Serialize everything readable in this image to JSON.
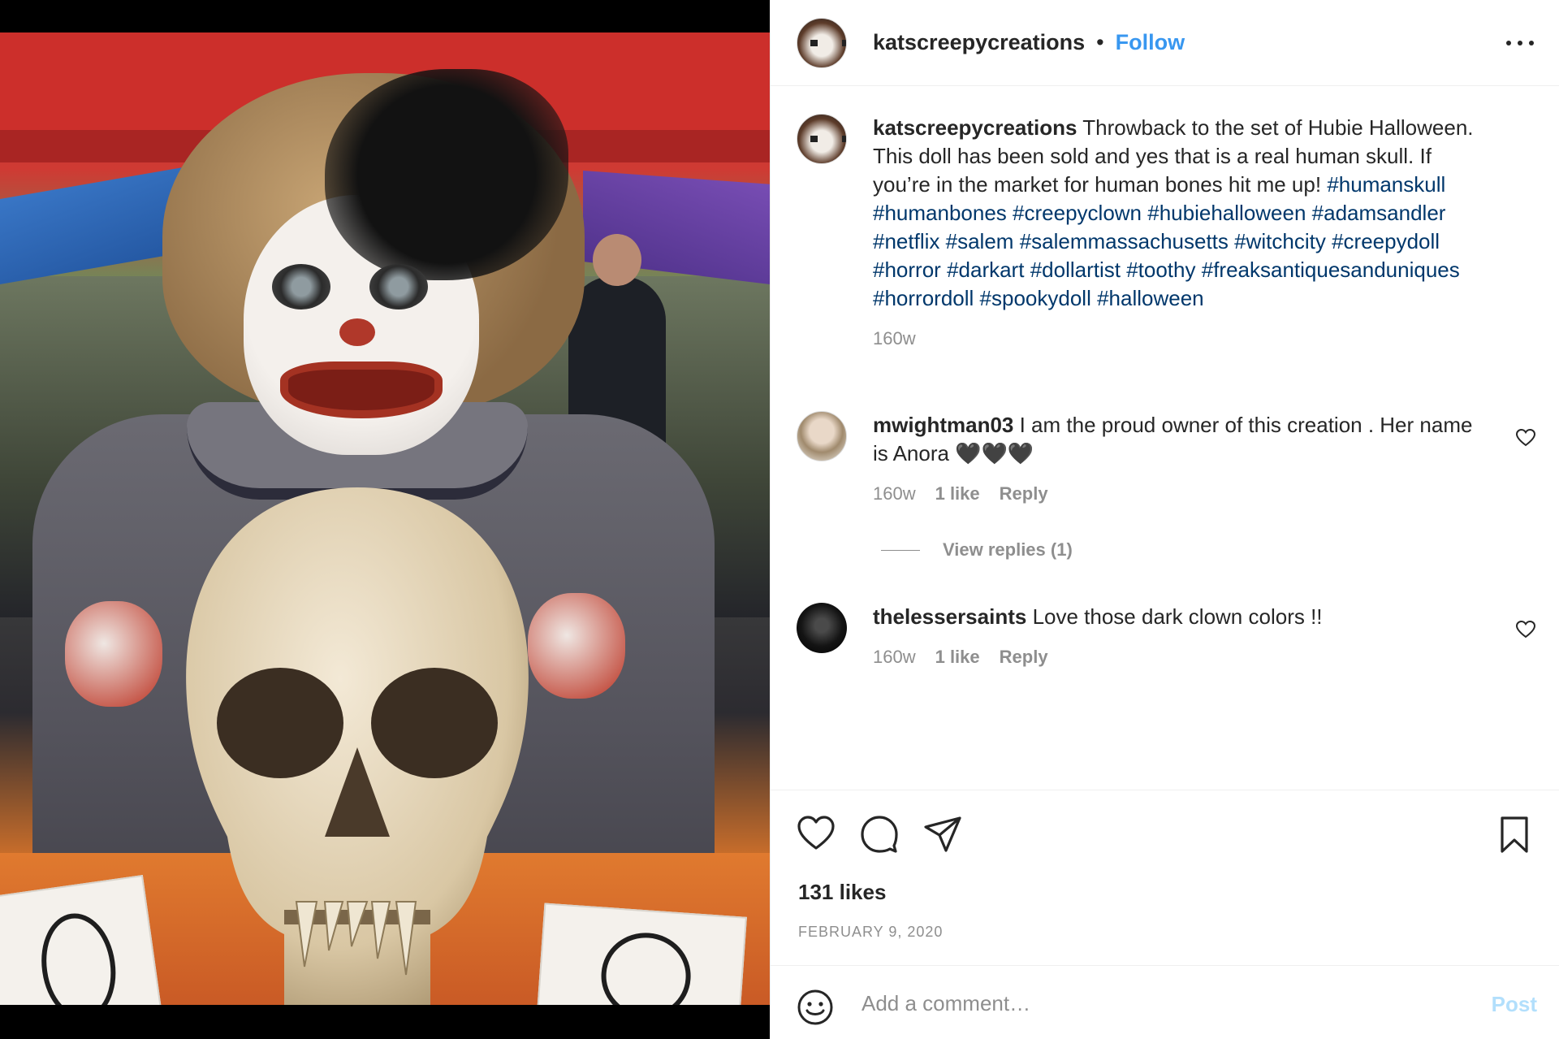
{
  "post": {
    "username": "katscreepycreations",
    "follow_label": "Follow",
    "separator": "•"
  },
  "caption": {
    "username": "katscreepycreations",
    "text": "Throwback to the set of Hubie Halloween. This doll has been sold and yes that is a real human skull. If you’re in the market for human bones hit me up!",
    "hashtags": [
      "#humanskull",
      "#humanbones",
      "#creepyclown",
      "#hubiehalloween",
      "#adamsandler",
      "#netflix",
      "#salem",
      "#salemmassachusetts",
      "#witchcity",
      "#creepydoll",
      "#horror",
      "#darkart",
      "#dollartist",
      "#toothy",
      "#freaksantiquesanduniques",
      "#horrordoll",
      "#spookydoll",
      "#halloween"
    ],
    "age": "160w"
  },
  "comments": [
    {
      "username": "mwightman03",
      "text": "I am the proud owner of this creation . Her name is Anora 🖤🖤🖤",
      "age": "160w",
      "likes": "1 like",
      "reply_label": "Reply",
      "view_replies": "View replies (1)"
    },
    {
      "username": "thelessersaints",
      "text": "Love those dark clown colors !!",
      "age": "160w",
      "likes": "1 like",
      "reply_label": "Reply"
    }
  ],
  "footer": {
    "likes": "131 likes",
    "date": "FEBRUARY 9, 2020",
    "comment_placeholder": "Add a comment…",
    "post_label": "Post"
  },
  "icons": {
    "more": "more-options-icon",
    "like": "heart-icon",
    "comment": "comment-bubble-icon",
    "share": "paper-plane-icon",
    "save": "bookmark-icon",
    "emoji": "smiley-icon"
  },
  "colors": {
    "link": "#3897f0",
    "hashtag": "#00376b",
    "muted": "#8e8e8e",
    "post_disabled": "#b2dffc"
  }
}
